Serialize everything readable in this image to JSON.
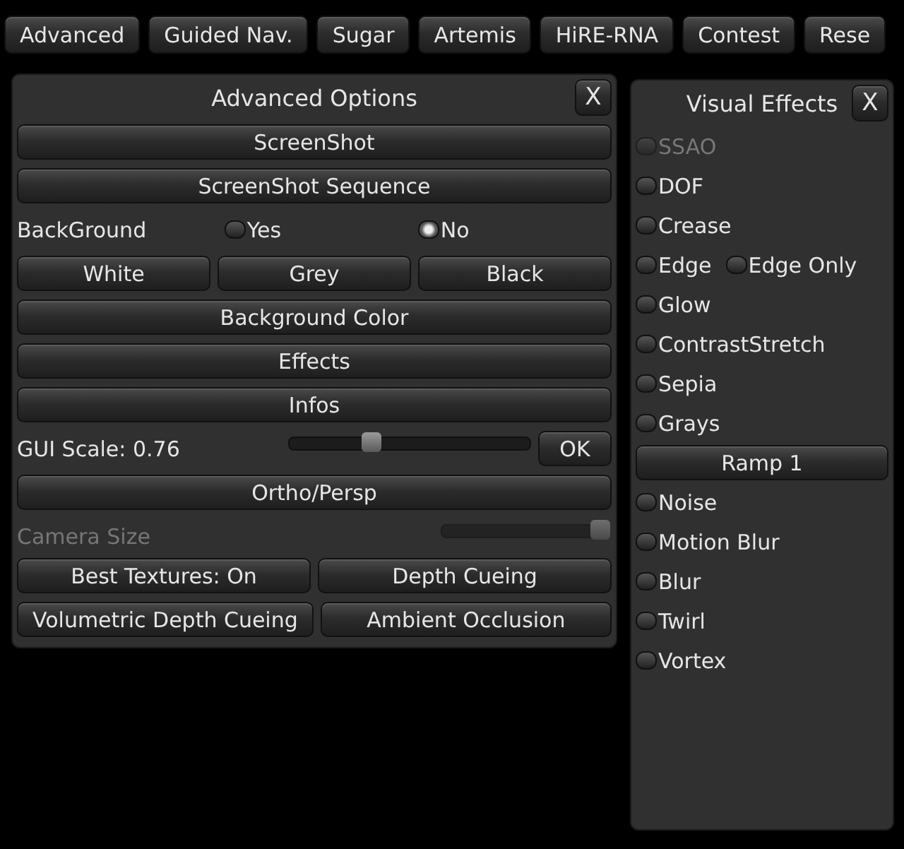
{
  "toolbar": [
    "Advanced",
    "Guided Nav.",
    "Sugar",
    "Artemis",
    "HiRE-RNA",
    "Contest",
    "Rese"
  ],
  "advanced_options": {
    "title": "Advanced Options",
    "close": "X",
    "rows": [
      {
        "kind": "button",
        "label": "ScreenShot"
      },
      {
        "kind": "button",
        "label": "ScreenShot Sequence"
      },
      {
        "kind": "radio",
        "label": "BackGround",
        "options": [
          {
            "label": "Yes",
            "selected": false
          },
          {
            "label": "No",
            "selected": true
          }
        ]
      },
      {
        "kind": "buttons",
        "buttons": [
          "White",
          "Grey",
          "Black"
        ]
      },
      {
        "kind": "button",
        "label": "Background Color"
      },
      {
        "kind": "button",
        "label": "Effects"
      },
      {
        "kind": "button",
        "label": "Infos"
      },
      {
        "kind": "slider",
        "label": "GUI Scale: 0.76",
        "level": 0.34,
        "disabled": false,
        "button": "OK"
      },
      {
        "kind": "button",
        "label": "Ortho/Persp"
      },
      {
        "kind": "slider",
        "label": "Camera Size",
        "level": 1.0,
        "disabled": true
      },
      {
        "kind": "buttons",
        "buttons": [
          "Best Textures: On",
          "Depth Cueing"
        ]
      },
      {
        "kind": "buttons",
        "buttons": [
          "Volumetric Depth Cueing",
          "Ambient Occlusion"
        ]
      }
    ]
  },
  "visual_effects": {
    "title": "Visual Effects",
    "close": "X",
    "items": [
      {
        "kind": "toggle",
        "toggles": [
          {
            "label": "SSAO",
            "checked": false,
            "disabled": true
          }
        ]
      },
      {
        "kind": "toggle",
        "toggles": [
          {
            "label": "DOF",
            "checked": false,
            "disabled": false
          }
        ]
      },
      {
        "kind": "toggle",
        "toggles": [
          {
            "label": "Crease",
            "checked": false,
            "disabled": false
          }
        ]
      },
      {
        "kind": "toggle",
        "toggles": [
          {
            "label": "Edge",
            "checked": false,
            "disabled": false
          },
          {
            "label": "Edge Only",
            "checked": false,
            "disabled": false
          }
        ]
      },
      {
        "kind": "toggle",
        "toggles": [
          {
            "label": "Glow",
            "checked": false,
            "disabled": false
          }
        ]
      },
      {
        "kind": "toggle",
        "toggles": [
          {
            "label": "ContrastStretch",
            "checked": false,
            "disabled": false
          }
        ]
      },
      {
        "kind": "toggle",
        "toggles": [
          {
            "label": "Sepia",
            "checked": false,
            "disabled": false
          }
        ]
      },
      {
        "kind": "toggle",
        "toggles": [
          {
            "label": "Grays",
            "checked": false,
            "disabled": false
          }
        ]
      },
      {
        "kind": "button",
        "label": "Ramp 1"
      },
      {
        "kind": "toggle",
        "toggles": [
          {
            "label": "Noise",
            "checked": false,
            "disabled": false
          }
        ]
      },
      {
        "kind": "toggle",
        "toggles": [
          {
            "label": "Motion Blur",
            "checked": false,
            "disabled": false
          }
        ]
      },
      {
        "kind": "toggle",
        "toggles": [
          {
            "label": "Blur",
            "checked": false,
            "disabled": false
          }
        ]
      },
      {
        "kind": "toggle",
        "toggles": [
          {
            "label": "Twirl",
            "checked": false,
            "disabled": false
          }
        ]
      },
      {
        "kind": "toggle",
        "toggles": [
          {
            "label": "Vortex",
            "checked": false,
            "disabled": false
          }
        ]
      }
    ]
  }
}
